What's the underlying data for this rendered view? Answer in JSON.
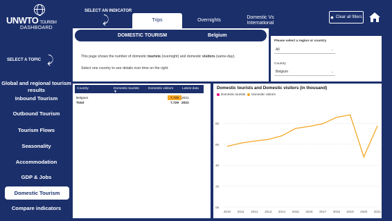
{
  "logo": {
    "brand": "UNWTO",
    "brand_small": "TOURISM",
    "dashboard": "DASHBOARD"
  },
  "sidebar": {
    "topic_label": "SELECT A TOPIC",
    "items": [
      {
        "label": "Global and regional tourism results"
      },
      {
        "label": "Inbound Tourism"
      },
      {
        "label": "Outbound Tourism"
      },
      {
        "label": "Tourism Flows"
      },
      {
        "label": "Seasonality"
      },
      {
        "label": "Accommodation"
      },
      {
        "label": "GDP & Jobs"
      },
      {
        "label": "Domestic Tourism",
        "active": true
      },
      {
        "label": "Compare indicators"
      }
    ]
  },
  "topbar": {
    "indicator_label": "SELECT AN INDICATOR",
    "tabs": [
      {
        "label": "Trips",
        "active": true
      },
      {
        "label": "Overnights"
      },
      {
        "label": "Domestic Vs International"
      }
    ],
    "clear_filters": "Clear all filters"
  },
  "header": {
    "title": "DOMESTIC TOURISM",
    "country": "Belgium"
  },
  "description": {
    "line1_a": "This page shows the number of domestic ",
    "line1_b": "tourists",
    "line1_c": " (overnight) and domestic ",
    "line1_d": "visitors",
    "line1_e": " (same-day).",
    "line2": "Select one country to see details over time on the right."
  },
  "filters": {
    "title": "Please select a region or country",
    "region_value": "All",
    "country_label": "Country",
    "country_value": "Belgium"
  },
  "table": {
    "headers": [
      "Country",
      "Domestic tourists",
      "Domestic visitors",
      "Latest data"
    ],
    "rows": [
      {
        "country": "Belgium",
        "tourists": "",
        "visitors": "7,729",
        "latest": "2021"
      },
      {
        "country": "Total",
        "tourists": "",
        "visitors": "7,729",
        "latest": "2021"
      }
    ],
    "bar_color": "#f5a623"
  },
  "chart_data": {
    "type": "line",
    "title": "Domestic tourists and Domestic visitors (in thousand)",
    "legend": [
      "Domestic tourists",
      "Domestic visitors"
    ],
    "legend_colors": [
      "#e6007e",
      "#f5a623"
    ],
    "x": [
      "2010",
      "2011",
      "2012",
      "2013",
      "2014",
      "2015",
      "2016",
      "2017",
      "2018",
      "2019",
      "2020",
      "2021"
    ],
    "series": [
      {
        "name": "Domestic visitors",
        "color": "#f5a623",
        "values": [
          5800,
          6100,
          6300,
          6450,
          6800,
          7500,
          7700,
          7950,
          8550,
          8800,
          4800,
          7750
        ]
      }
    ],
    "y_ticks": [
      "8K",
      "6K",
      "4K",
      "2K",
      "0K"
    ],
    "ylim": [
      0,
      10000
    ],
    "grid": true
  }
}
